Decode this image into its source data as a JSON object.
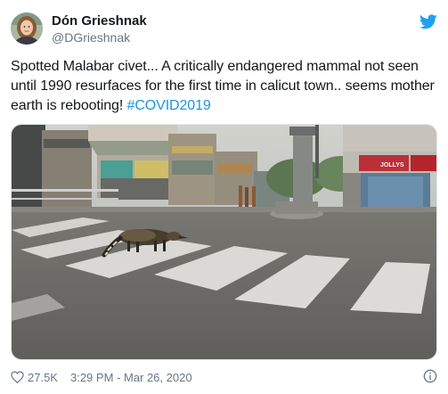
{
  "author": {
    "display_name": "Dón Grieshnak",
    "handle": "@DGrieshnak"
  },
  "tweet": {
    "text": "Spotted Malabar civet... A critically endangered mammal not seen until 1990 resurfaces for the first time in calicut town.. seems mother earth is rebooting! ",
    "hashtag": "#COVID2019"
  },
  "footer": {
    "likes": "27.5K",
    "timestamp": "3:29 PM - Mar 26, 2020"
  },
  "icons": {
    "brand": "twitter-bird-icon",
    "like": "heart-icon",
    "info": "info-icon"
  },
  "colors": {
    "brand_blue": "#1da1f2",
    "link_blue": "#1b95e0",
    "muted_gray": "#657786",
    "text_dark": "#14171a"
  },
  "sign_text": {
    "shop_sign": "JOLLYS"
  }
}
